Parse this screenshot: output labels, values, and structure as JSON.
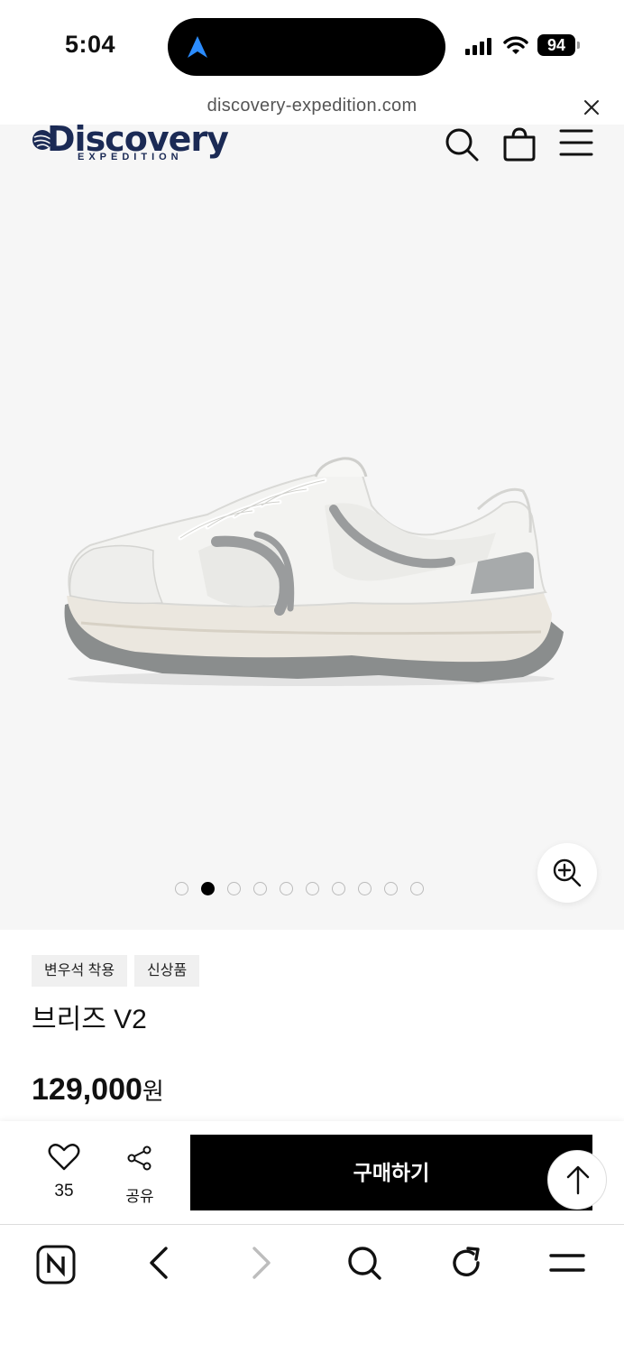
{
  "status": {
    "time": "5:04",
    "battery": "94"
  },
  "browser": {
    "url": "discovery-expedition.com"
  },
  "header": {
    "brand": "Discovery",
    "brand_sub": "EXPEDITION"
  },
  "gallery": {
    "image_alt": "브리즈 V2",
    "dot_count": 10,
    "active_dot": 1
  },
  "product": {
    "tags": [
      "변우석 착용",
      "신상품"
    ],
    "title": "브리즈 V2",
    "price": "129,000",
    "currency": "원"
  },
  "actions": {
    "like_count": "35",
    "share_label": "공유",
    "buy_label": "구매하기"
  },
  "icons": {
    "header": [
      "search-icon",
      "shopping-bag-icon",
      "menu-icon"
    ],
    "toolbar": [
      "naver-home-icon",
      "back-icon",
      "forward-icon",
      "search-icon",
      "reload-icon",
      "menu-icon"
    ]
  }
}
